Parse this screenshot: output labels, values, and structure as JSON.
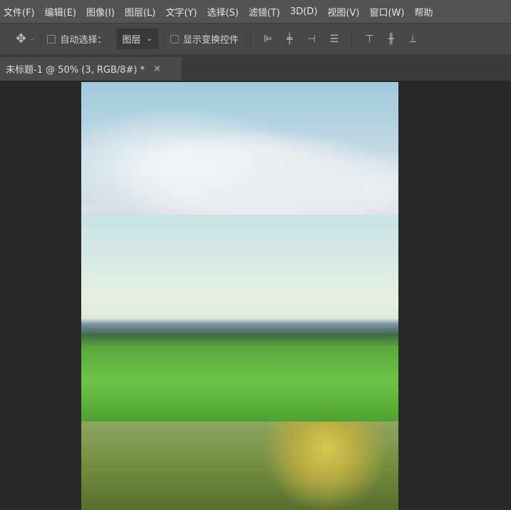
{
  "menu": [
    "文件(F)",
    "编辑(E)",
    "图像(I)",
    "图层(L)",
    "文字(Y)",
    "选择(S)",
    "滤镜(T)",
    "3D(D)",
    "视图(V)",
    "窗口(W)",
    "帮助"
  ],
  "options": {
    "move_icon": "move-icon",
    "auto_select": "自动选择：",
    "layer_select": "图层",
    "show_transform": "显示变换控件"
  },
  "document_tab": {
    "title": "未标题-1 @ 50% (3, RGB/8#) *",
    "close": "×"
  }
}
